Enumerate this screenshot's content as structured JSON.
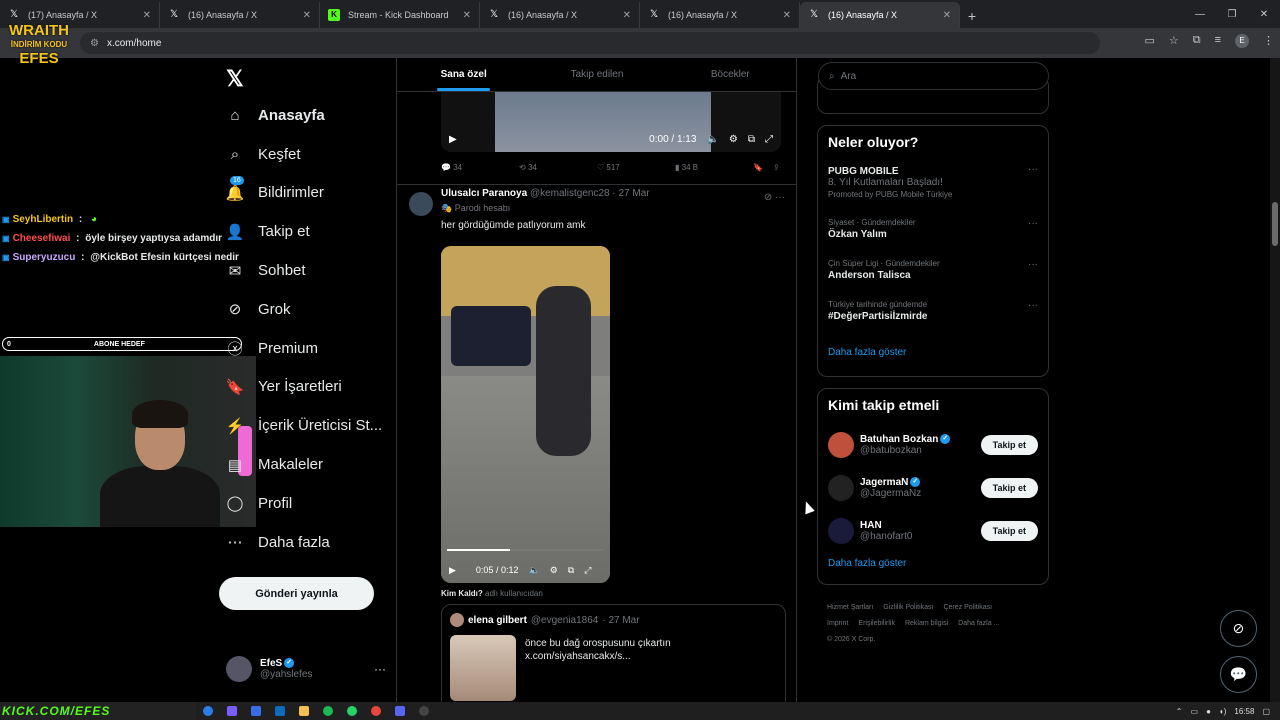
{
  "browser": {
    "tabs": [
      {
        "title": "(17) Anasayfa / X",
        "icon": "x-icon",
        "active": false
      },
      {
        "title": "(16) Anasayfa / X",
        "icon": "x-icon",
        "active": false
      },
      {
        "title": "Stream - Kick Dashboard",
        "icon": "kick-icon",
        "active": false
      },
      {
        "title": "(16) Anasayfa / X",
        "icon": "x-icon",
        "active": false
      },
      {
        "title": "(16) Anasayfa / X",
        "icon": "x-icon",
        "active": false
      },
      {
        "title": "(16) Anasayfa / X",
        "icon": "x-icon",
        "active": true
      }
    ],
    "url": "x.com/home"
  },
  "overlay": {
    "brand_top": "WRAITH",
    "brand_mid": "İNDİRİM KODU",
    "brand_bottom": "EFES",
    "chat": [
      {
        "user": "SeyhLibertin",
        "sep": " : ",
        "text": "",
        "color": "#f5c518"
      },
      {
        "user": "Cheesefiwai",
        "sep": " : ",
        "text": "öyle birşey yaptıysa adamdır",
        "color": "#ff4d4d"
      },
      {
        "user": "Superyuzucu",
        "sep": " : ",
        "text": "@KickBot Efesin kürtçesi nedir",
        "color": "#c9a7ff",
        "mention_color": "#9fb4ff"
      }
    ],
    "goal_value": "0",
    "goal_label": "ABONE HEDEF",
    "kick_url": "KICK.COM/EFES"
  },
  "nav": {
    "items": [
      {
        "label": "Anasayfa",
        "icon": "home-icon",
        "active": true
      },
      {
        "label": "Keşfet",
        "icon": "search-icon"
      },
      {
        "label": "Bildirimler",
        "icon": "bell-icon",
        "badge": "16"
      },
      {
        "label": "Takip et",
        "icon": "add-user-icon"
      },
      {
        "label": "Sohbet",
        "icon": "mail-icon"
      },
      {
        "label": "Grok",
        "icon": "grok-icon"
      },
      {
        "label": "Premium",
        "icon": "x-circle-icon"
      },
      {
        "label": "Yer İşaretleri",
        "icon": "bookmark-icon"
      },
      {
        "label": "İçerik Üreticisi St...",
        "icon": "creator-icon"
      },
      {
        "label": "Makaleler",
        "icon": "article-icon"
      },
      {
        "label": "Profil",
        "icon": "person-icon"
      },
      {
        "label": "Daha fazla",
        "icon": "more-circle-icon"
      }
    ],
    "post_button": "Gönderi yayınla",
    "account": {
      "name": "EfeS",
      "handle": "@yahslefes"
    }
  },
  "feed": {
    "tabs": [
      "Sana özel",
      "Takip edilen",
      "Böcekler"
    ],
    "prev_post": {
      "video_time": "0:00 / 1:13",
      "replies": "34",
      "reposts": "34",
      "likes": "517",
      "views": "34 B"
    },
    "post": {
      "author": "Ulusalcı Paranoya",
      "handle": "@kemalistgenc28",
      "date": "· 27 Mar",
      "parody": "Parodi hesabı",
      "text": "her gördüğümde patlıyorum amk",
      "video_time": "0:05 / 0:12",
      "progress": 0.4,
      "quote_label": "Kim Kaldı?",
      "quote_label_sub": "adlı kullanıcıdan",
      "quote": {
        "author": "elena gilbert",
        "handle": "@evgenia1864",
        "date": "· 27 Mar",
        "text": "önce bu dağ orospusunu çıkartın x.com/siyahsancakx/s..."
      }
    }
  },
  "sidebar": {
    "search_placeholder": "Ara",
    "trends_title": "Neler oluyor?",
    "trends": [
      {
        "category": "",
        "title": "PUBG MOBILE",
        "subtitle": "8. Yıl Kutlamaları Başladı!",
        "promo": "Promoted by PUBG Mobile Türkiye"
      },
      {
        "category": "Siyaset · Gündemdekiler",
        "title": "Özkan Yalım",
        "subtitle": "",
        "promo": ""
      },
      {
        "category": "Çin Süper Ligi · Gündemdekiler",
        "title": "Anderson Talisca",
        "subtitle": "",
        "promo": ""
      },
      {
        "category": "Türkiye tarihinde gündemde",
        "title": "#DeğerPartisiİzmirde",
        "subtitle": "",
        "promo": ""
      }
    ],
    "show_more": "Daha fazla göster",
    "who_title": "Kimi takip etmeli",
    "who": [
      {
        "name": "Batuhan Bozkan",
        "handle": "@batubozkan",
        "button": "Takip et",
        "avatar_color": "#c0503c"
      },
      {
        "name": "JagermaN",
        "handle": "@JagermaNz",
        "button": "Takip et",
        "avatar_color": "#222222"
      },
      {
        "name": "HAN",
        "handle": "@hanofart0",
        "button": "Takip et",
        "avatar_color": "#1a1a3a"
      }
    ],
    "who_show_more": "Daha fazla göster",
    "footer": [
      "Hizmet Şartları",
      "Gizlilik Politikası",
      "Çerez Politikası",
      "Imprint",
      "Erişilebilirlik",
      "Reklam bilgisi",
      "Daha fazla ...",
      "© 2026 X Corp."
    ]
  },
  "taskbar": {
    "time": "16:58"
  }
}
